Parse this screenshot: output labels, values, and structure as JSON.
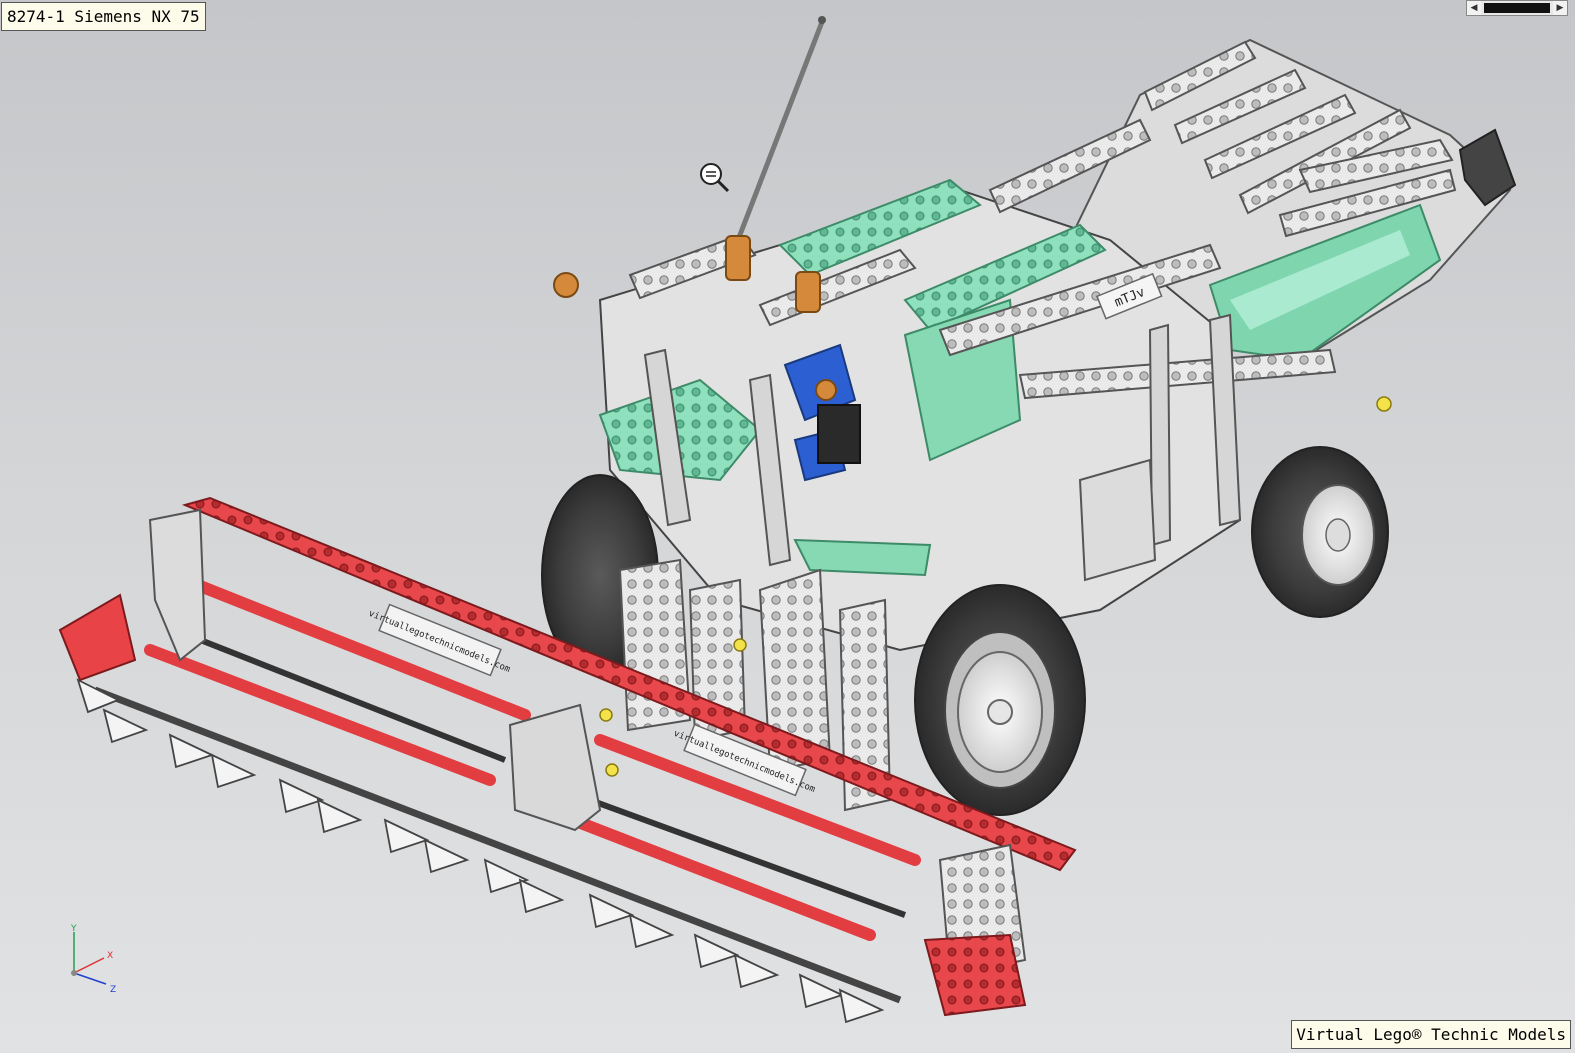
{
  "window": {
    "title": "8274-1 Siemens NX 75"
  },
  "credit": {
    "text": "Virtual Lego® Technic Models"
  },
  "model": {
    "imprint_text": "virtuallegotechnicmodels.com",
    "logo_text": "mTJv",
    "colors": {
      "red": "#e74044",
      "green": "#88dcb5",
      "lightgray": "#ececec",
      "darkgray": "#6b6b6b",
      "tire": "#3f3f3f"
    }
  },
  "triad": {
    "x_label": "X",
    "y_label": "Y",
    "z_label": "Z",
    "x_color": "#e03030",
    "y_color": "#20a050",
    "z_color": "#2040d0"
  },
  "icons": {
    "cursor": "zoom-magnifier-icon",
    "scroll_left": "chevron-left-icon",
    "scroll_right": "chevron-right-icon"
  }
}
